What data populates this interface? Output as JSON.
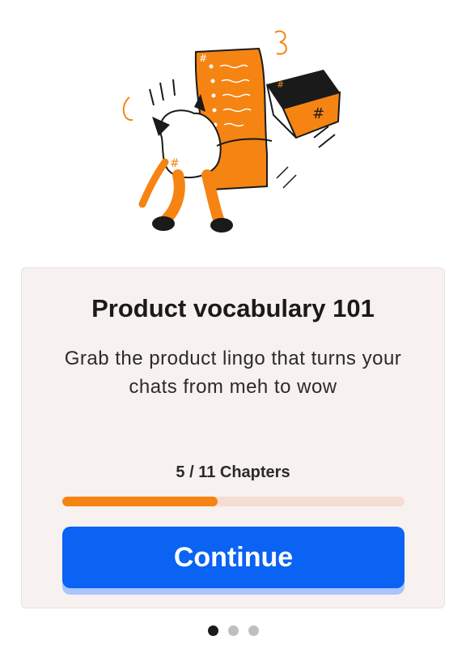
{
  "card": {
    "title": "Product vocabulary 101",
    "subtitle": "Grab the product lingo that turns your chats from meh to wow",
    "progress_label": "5 / 11 Chapters",
    "progress_completed": 5,
    "progress_total": 11,
    "continue_label": "Continue"
  },
  "pagination": {
    "pages": 3,
    "active_index": 0
  },
  "illustration": {
    "icon": "cat-character-with-document-and-box-illustration"
  },
  "colors": {
    "accent_orange": "#f58413",
    "button_blue": "#0a63f2",
    "button_shadow": "#a9c4ff",
    "card_background": "#f7f1ef",
    "track": "#f5ddd3"
  }
}
